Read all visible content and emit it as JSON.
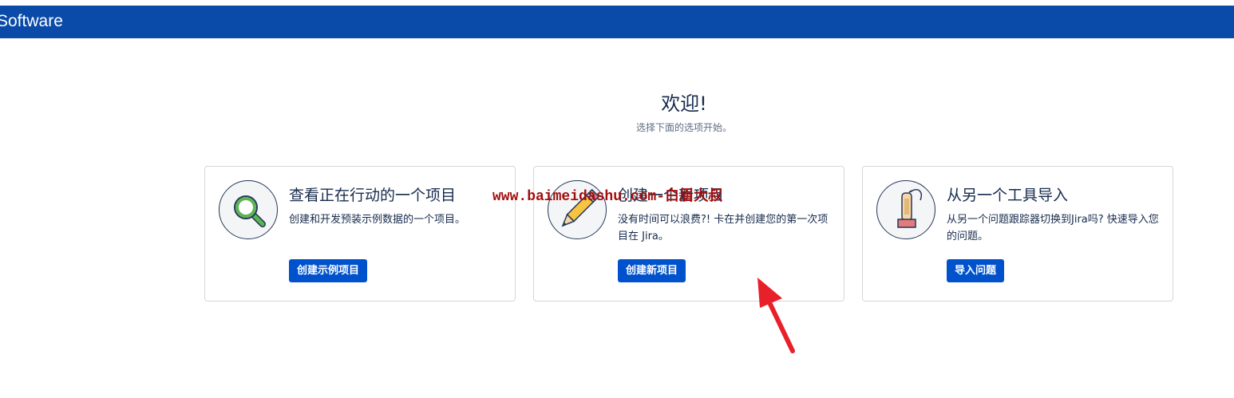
{
  "header": {
    "brand": "Software"
  },
  "welcome": {
    "title": "欢迎!",
    "subtitle": "选择下面的选项开始。"
  },
  "cards": [
    {
      "title": "查看正在行动的一个项目",
      "description": "创建和开发预装示例数据的一个项目。",
      "button": "创建示例项目",
      "icon": "magnifier-icon"
    },
    {
      "title": "创建一个新项目",
      "description": "没有时间可以浪费?! 卡在并创建您的第一次项目在 Jira。",
      "button": "创建新项目",
      "icon": "pencil-icon"
    },
    {
      "title": "从另一个工具导入",
      "description": "从另一个问题跟踪器切换到Jira吗? 快速导入您的问题。",
      "button": "导入问题",
      "icon": "vacuum-icon"
    }
  ],
  "overlay": {
    "watermark": "www.baimeidashu.com-白眉大叔",
    "annotation": "red-arrow"
  },
  "colors": {
    "header_bg": "#0a4aa8",
    "button_bg": "#0052cc",
    "watermark": "#a30d0d",
    "arrow": "#e8202a"
  }
}
